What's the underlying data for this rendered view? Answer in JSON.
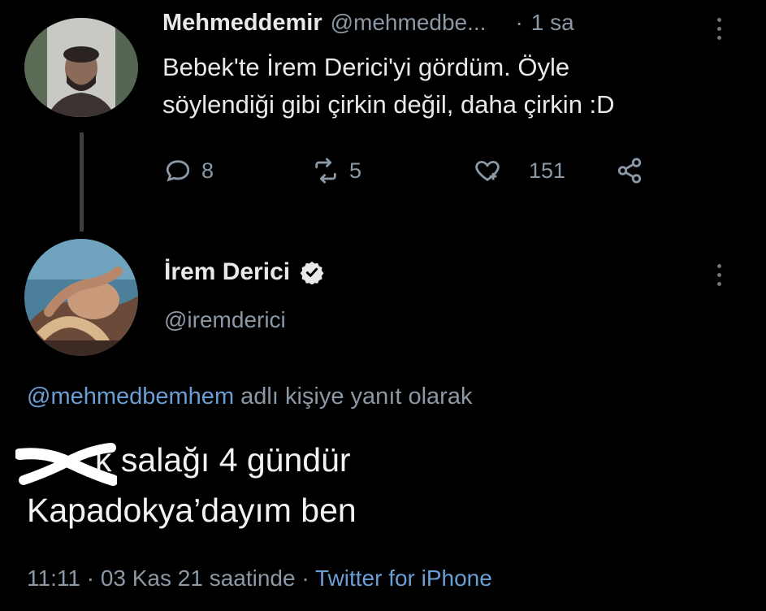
{
  "tweet1": {
    "display_name": "Mehmeddemir",
    "handle": "@mehmedbe...",
    "time": "1 sa",
    "text_line1": "Bebek'te İrem Derici'yi gördüm. Öyle",
    "text_line2": "söylendiği gibi çirkin değil, daha çirkin :D",
    "reply_count": "8",
    "retweet_count": "5",
    "like_count": "151"
  },
  "tweet2": {
    "display_name": "İrem Derici",
    "handle": "@iremderici",
    "reply_to_handle": "@mehmedbemhem",
    "reply_to_suffix": "adlı kişiye yanıt olarak",
    "text_line1_visible": "k salağı 4 gündür",
    "text_line2": "Kapadokya’dayım ben",
    "time": "11:11",
    "date": "03 Kas 21 saatinde",
    "source": "Twitter for iPhone"
  },
  "colors": {
    "background": "#000000",
    "primary_text": "#e7e9ea",
    "secondary_text": "#8b98a5",
    "link": "#6a9fd6"
  }
}
